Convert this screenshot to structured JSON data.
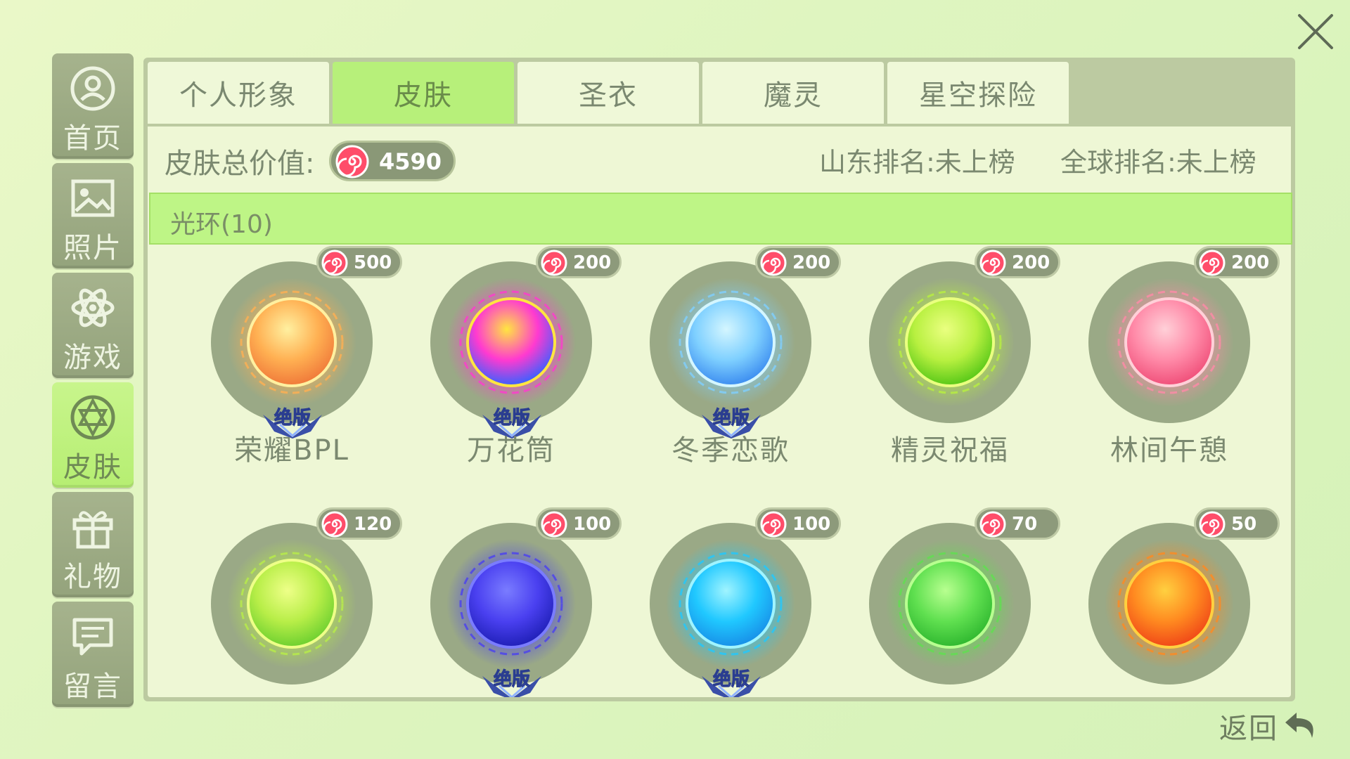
{
  "close_icon": "close-icon",
  "sidebar": {
    "items": [
      {
        "label": "首页",
        "icon": "user-circle-icon",
        "active": false
      },
      {
        "label": "照片",
        "icon": "photo-icon",
        "active": false
      },
      {
        "label": "游戏",
        "icon": "atom-icon",
        "active": false
      },
      {
        "label": "皮肤",
        "icon": "skin-emblem-icon",
        "active": true
      },
      {
        "label": "礼物",
        "icon": "gift-icon",
        "active": false
      },
      {
        "label": "留言",
        "icon": "message-icon",
        "active": false
      }
    ]
  },
  "tabs": [
    {
      "label": "个人形象",
      "active": false
    },
    {
      "label": "皮肤",
      "active": true
    },
    {
      "label": "圣衣",
      "active": false
    },
    {
      "label": "魔灵",
      "active": false
    },
    {
      "label": "星空探险",
      "active": false
    }
  ],
  "summary": {
    "total_label": "皮肤总价值:",
    "total_value": "4590",
    "shandong_rank": "山东排名:未上榜",
    "global_rank": "全球排名:未上榜"
  },
  "section": {
    "title": "光环(10)"
  },
  "badge_text": "绝版",
  "skins": [
    {
      "name": "荣耀BPL",
      "price": "500",
      "limited": true,
      "colors": [
        "#fff0a0",
        "#ffb052",
        "#f07a3a"
      ]
    },
    {
      "name": "万花筒",
      "price": "200",
      "limited": true,
      "colors": [
        "#ffe640",
        "#ff3ad0",
        "#3a60ff"
      ]
    },
    {
      "name": "冬季恋歌",
      "price": "200",
      "limited": true,
      "colors": [
        "#d4f6ff",
        "#7fd0ff",
        "#3c8df0"
      ]
    },
    {
      "name": "精灵祝福",
      "price": "200",
      "limited": false,
      "colors": [
        "#eaff80",
        "#b8f040",
        "#58c818"
      ]
    },
    {
      "name": "林间午憩",
      "price": "200",
      "limited": false,
      "colors": [
        "#ffd0d8",
        "#ff8aa8",
        "#f0507a"
      ]
    },
    {
      "name": "",
      "price": "120",
      "limited": false,
      "colors": [
        "#eeff88",
        "#b8ee48",
        "#6ed030"
      ]
    },
    {
      "name": "",
      "price": "100",
      "limited": true,
      "colors": [
        "#7a7cff",
        "#4a40f0",
        "#2020b8"
      ]
    },
    {
      "name": "",
      "price": "100",
      "limited": true,
      "colors": [
        "#a0f4ff",
        "#20c8ff",
        "#1890e8"
      ]
    },
    {
      "name": "",
      "price": "70",
      "limited": false,
      "colors": [
        "#b8ff90",
        "#60e050",
        "#30b830"
      ]
    },
    {
      "name": "",
      "price": "50",
      "limited": false,
      "colors": [
        "#ffd040",
        "#ff8a20",
        "#f04818"
      ]
    }
  ],
  "back": {
    "label": "返回",
    "icon": "back-arrow-icon"
  }
}
